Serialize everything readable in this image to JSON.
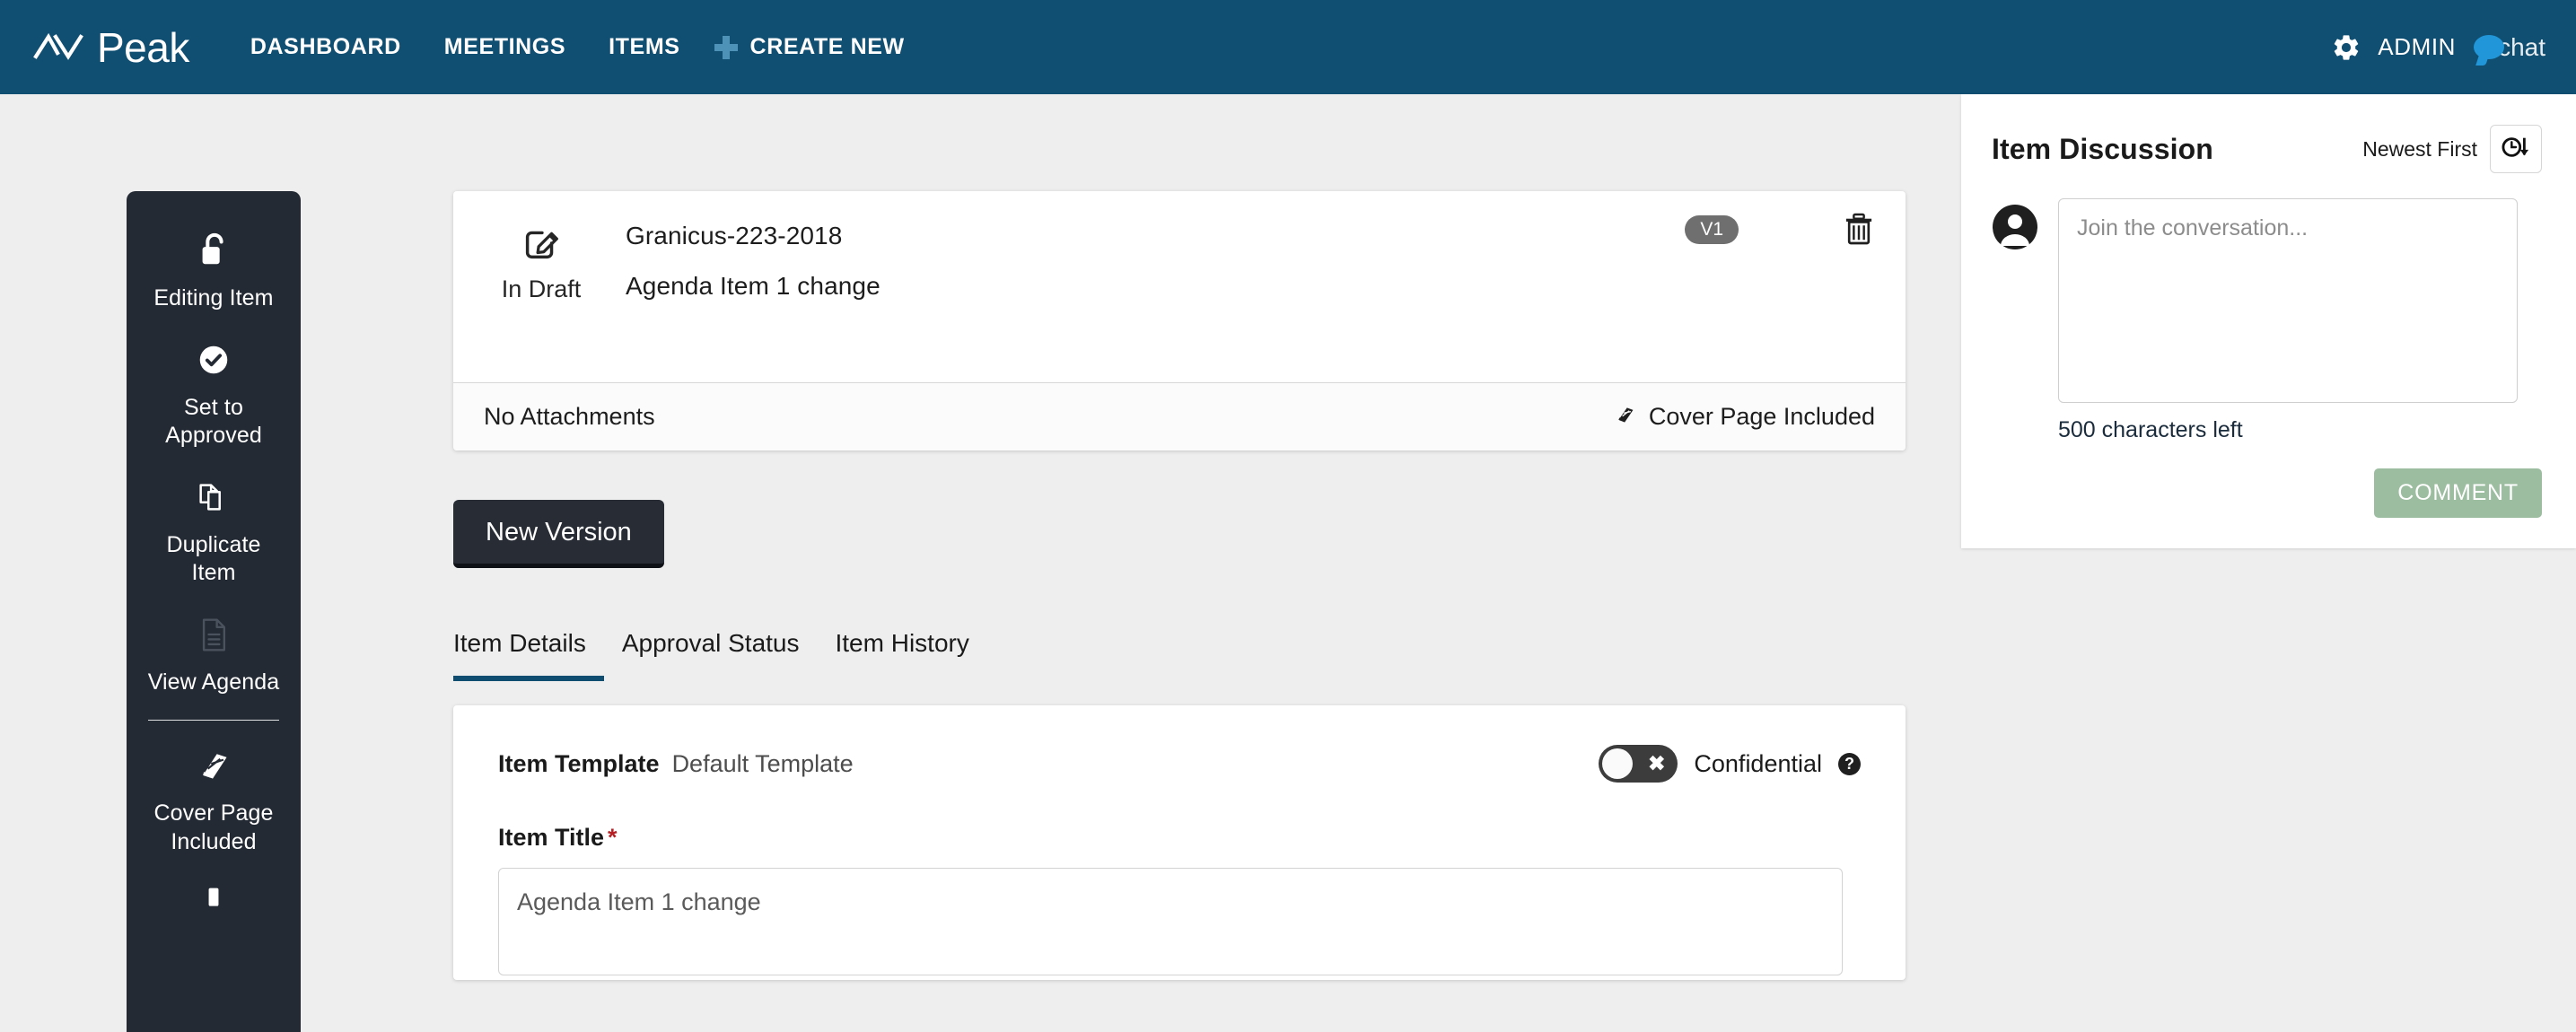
{
  "header": {
    "brand": "Peak",
    "brand_mark_icon": "peak-logo-icon",
    "nav": [
      {
        "label": "DASHBOARD",
        "name": "nav-dashboard"
      },
      {
        "label": "MEETINGS",
        "name": "nav-meetings"
      },
      {
        "label": "ITEMS",
        "name": "nav-items"
      }
    ],
    "create_new": "CREATE NEW",
    "admin": "ADMIN",
    "chat": "chat",
    "accent_plus": "#4f92b8",
    "chat_bubble_color": "#2196d8",
    "bg": "#114f72"
  },
  "rail": {
    "items": [
      {
        "label": "Editing Item",
        "icon": "unlock-icon"
      },
      {
        "label": "Set to\nApproved",
        "icon": "check-circle-icon"
      },
      {
        "label": "Duplicate\nItem",
        "icon": "duplicate-icon"
      },
      {
        "label": "View Agenda",
        "icon": "document-icon"
      },
      {
        "label": "Cover Page\nIncluded",
        "icon": "book-icon"
      }
    ],
    "bg": "#242a33"
  },
  "item_card": {
    "status_label": "In Draft",
    "status_icon": "edit-square-icon",
    "item_number": "Granicus-223-2018",
    "item_name": "Agenda Item 1 change",
    "version_badge": "V1",
    "delete_icon": "trash-icon",
    "attachments": "No Attachments",
    "cover_page": "Cover Page Included",
    "cover_page_icon": "book-icon",
    "badge_bg": "#6f6f6f"
  },
  "actions": {
    "new_version": "New Version"
  },
  "tabs": [
    {
      "label": "Item Details",
      "active": true
    },
    {
      "label": "Approval Status",
      "active": false
    },
    {
      "label": "Item History",
      "active": false
    }
  ],
  "details": {
    "template_label": "Item Template",
    "template_value": "Default Template",
    "confidential_label": "Confidential",
    "confidential_on": false,
    "confidential_glyph": "✖",
    "help_glyph": "?",
    "item_title_label": "Item Title",
    "required_marker": "*",
    "item_title_value": "Agenda Item 1 change",
    "accent": "#0e4d70"
  },
  "discussion": {
    "title": "Item Discussion",
    "sort_label": "Newest First",
    "sort_icon": "clock-arrow-down-icon",
    "avatar_icon": "user-avatar-icon",
    "comment_placeholder": "Join the conversation...",
    "comment_value": "",
    "chars_left": "500 characters left",
    "comment_button": "COMMENT",
    "comment_button_color": "#9cbda0"
  }
}
